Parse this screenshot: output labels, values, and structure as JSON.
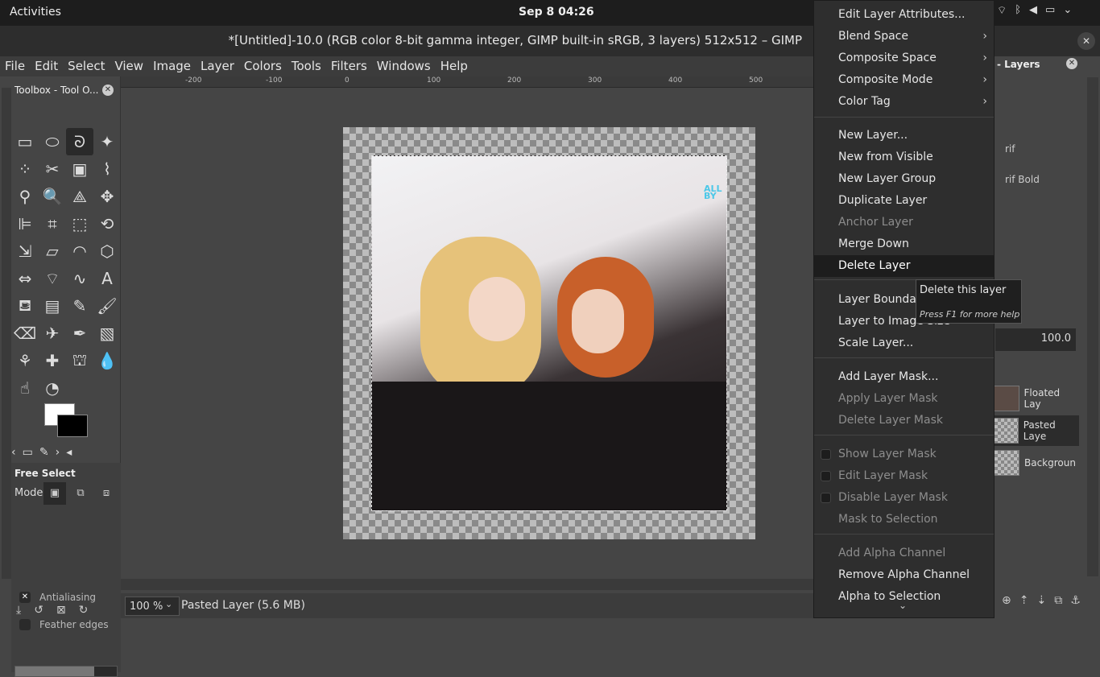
{
  "topbar": {
    "activities": "Activities",
    "clock": "Sep 8  04:26",
    "tray": [
      "wifi-icon",
      "bluetooth-icon",
      "volume-icon",
      "battery-icon",
      "chevron-down-icon"
    ]
  },
  "window": {
    "title": "*[Untitled]-10.0 (RGB color 8-bit gamma integer, GIMP built-in sRGB, 3 layers) 512x512 – GIMP",
    "close": "✕"
  },
  "menubar": {
    "file": "File",
    "edit": "Edit",
    "select": "Select",
    "view": "View",
    "image": "Image",
    "layer": "Layer",
    "colors": "Colors",
    "tools": "Tools",
    "filters": "Filters",
    "windows": "Windows",
    "help": "Help"
  },
  "ruler": {
    "marks": [
      "-200",
      "-100",
      "0",
      "100",
      "200",
      "300",
      "400",
      "500"
    ]
  },
  "toolbox": {
    "title": "Toolbox - Tool O...",
    "close": "✕",
    "tools": [
      {
        "name": "rect-select-icon",
        "glyph": "▭"
      },
      {
        "name": "ellipse-select-icon",
        "glyph": "⬭"
      },
      {
        "name": "free-select-icon",
        "glyph": "ᘐ"
      },
      {
        "name": "fuzzy-select-icon",
        "glyph": "✦"
      },
      {
        "name": "select-by-color-icon",
        "glyph": "⁘"
      },
      {
        "name": "scissors-select-icon",
        "glyph": "✂"
      },
      {
        "name": "foreground-select-icon",
        "glyph": "▣"
      },
      {
        "name": "paths-icon",
        "glyph": "⌇"
      },
      {
        "name": "color-picker-icon",
        "glyph": "⚲"
      },
      {
        "name": "zoom-icon",
        "glyph": "🔍"
      },
      {
        "name": "measure-icon",
        "glyph": "⟁"
      },
      {
        "name": "move-icon",
        "glyph": "✥"
      },
      {
        "name": "align-icon",
        "glyph": "⊫"
      },
      {
        "name": "crop-icon",
        "glyph": "⌗"
      },
      {
        "name": "unified-transform-icon",
        "glyph": "⬚"
      },
      {
        "name": "rotate-icon",
        "glyph": "⟲"
      },
      {
        "name": "scale-icon",
        "glyph": "⇲"
      },
      {
        "name": "shear-icon",
        "glyph": "▱"
      },
      {
        "name": "warp-icon",
        "glyph": "◠"
      },
      {
        "name": "3d-transform-icon",
        "glyph": "⬡"
      },
      {
        "name": "flip-icon",
        "glyph": "⇔"
      },
      {
        "name": "cage-icon",
        "glyph": "⌔"
      },
      {
        "name": "wave-icon",
        "glyph": "∿"
      },
      {
        "name": "text-icon",
        "glyph": "A"
      },
      {
        "name": "bucket-fill-icon",
        "glyph": "⛾"
      },
      {
        "name": "gradient-icon",
        "glyph": "▤"
      },
      {
        "name": "pencil-icon",
        "glyph": "✎"
      },
      {
        "name": "paintbrush-icon",
        "glyph": "🖌"
      },
      {
        "name": "eraser-icon",
        "glyph": "⌫"
      },
      {
        "name": "airbrush-icon",
        "glyph": "✈"
      },
      {
        "name": "ink-icon",
        "glyph": "✒"
      },
      {
        "name": "mypaint-brush-icon",
        "glyph": "▧"
      },
      {
        "name": "clone-icon",
        "glyph": "⚘"
      },
      {
        "name": "heal-icon",
        "glyph": "✚"
      },
      {
        "name": "perspective-clone-icon",
        "glyph": "⛫"
      },
      {
        "name": "blur-icon",
        "glyph": "💧"
      },
      {
        "name": "smudge-icon",
        "glyph": "☝"
      },
      {
        "name": "dodge-burn-icon",
        "glyph": "◔"
      }
    ],
    "active_tool": "free-select-icon",
    "colors": {
      "foreground": "#ffffff",
      "background": "#000000"
    },
    "tabs": [
      "chevron-left-icon",
      "device-status-icon",
      "tool-options-icon",
      "chevron-right-icon",
      "configure-icon"
    ],
    "bottom_buttons": [
      "save-icon",
      "restore-icon",
      "delete-icon",
      "reset-icon"
    ]
  },
  "tool_options": {
    "title": "Free Select",
    "mode_label": "Mode:",
    "modes": [
      "replace-mode-icon",
      "add-mode-icon",
      "subtract-mode-icon"
    ],
    "antialiasing": {
      "label": "Antialiasing",
      "checked": true,
      "mark": "✕"
    },
    "feather": {
      "label": "Feather edges",
      "checked": false
    }
  },
  "canvas": {
    "watermark": "ALL BY"
  },
  "statusbar": {
    "zoom": "100 %",
    "zoom_arrow": "⌄",
    "message": "Pasted Layer (5.6 MB)"
  },
  "right_panel": {
    "title": "- Layers",
    "close": "✕",
    "font_item1": "rif",
    "font_item2": "rif Bold",
    "opacity": "100.0",
    "layers": [
      {
        "name": "Floated Lay",
        "selected": false
      },
      {
        "name": "Pasted Laye",
        "selected": true
      },
      {
        "name": "Backgroun",
        "selected": false
      }
    ],
    "bottom_buttons": [
      "new-layer-icon",
      "raise-layer-icon",
      "lower-layer-icon",
      "duplicate-layer-icon",
      "anchor-icon"
    ]
  },
  "context_menu": {
    "items": [
      {
        "label": "Edit Layer Attributes...",
        "disabled": false
      },
      {
        "label": "Blend Space",
        "submenu": true
      },
      {
        "label": "Composite Space",
        "submenu": true
      },
      {
        "label": "Composite Mode",
        "submenu": true
      },
      {
        "label": "Color Tag",
        "submenu": true
      },
      {
        "label": "New Layer...",
        "disabled": false
      },
      {
        "label": "New from Visible",
        "disabled": false
      },
      {
        "label": "New Layer Group",
        "disabled": false
      },
      {
        "label": "Duplicate Layer",
        "disabled": false
      },
      {
        "label": "Anchor Layer",
        "disabled": true
      },
      {
        "label": "Merge Down",
        "disabled": false
      },
      {
        "label": "Delete Layer",
        "highlighted": true
      },
      {
        "label": "Layer Boundary Size...",
        "disabled": false
      },
      {
        "label": "Layer to Image Size",
        "disabled": false
      },
      {
        "label": "Scale Layer...",
        "disabled": false
      },
      {
        "label": "Add Layer Mask...",
        "disabled": false
      },
      {
        "label": "Apply Layer Mask",
        "disabled": true
      },
      {
        "label": "Delete Layer Mask",
        "disabled": true
      },
      {
        "label": "Show Layer Mask",
        "disabled": true,
        "checkbox": true
      },
      {
        "label": "Edit Layer Mask",
        "disabled": true,
        "checkbox": true
      },
      {
        "label": "Disable Layer Mask",
        "disabled": true,
        "checkbox": true
      },
      {
        "label": "Mask to Selection",
        "disabled": true
      },
      {
        "label": "Add Alpha Channel",
        "disabled": true
      },
      {
        "label": "Remove Alpha Channel",
        "disabled": false
      },
      {
        "label": "Alpha to Selection",
        "disabled": false
      }
    ],
    "more": "⌄"
  },
  "tooltip": {
    "title": "Delete this layer",
    "help": "Press F1 for more help"
  }
}
